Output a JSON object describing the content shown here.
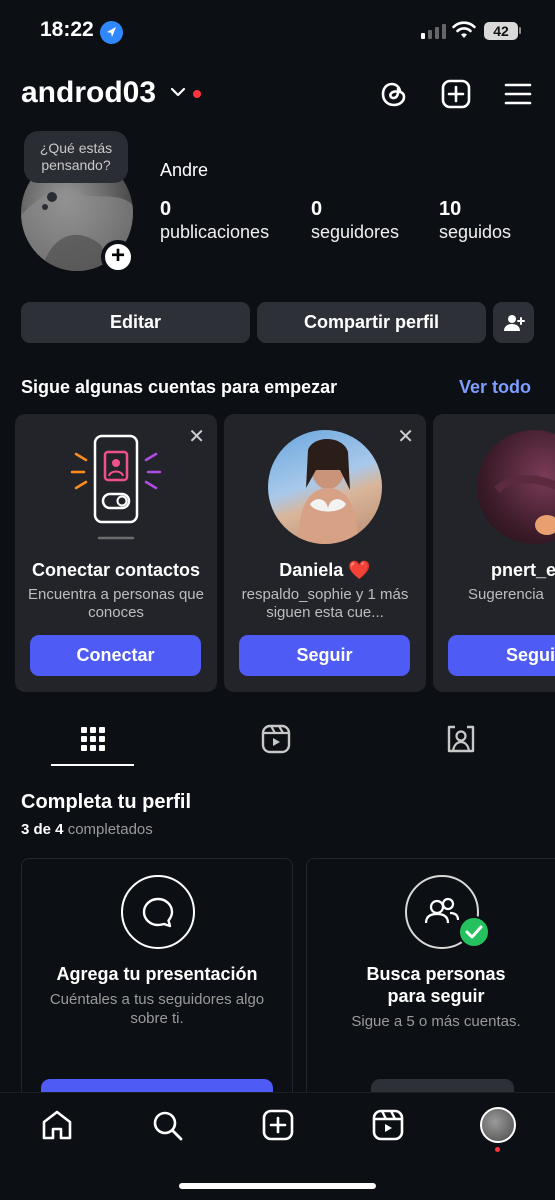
{
  "status": {
    "time": "18:22",
    "battery": "42"
  },
  "header": {
    "username": "androd03"
  },
  "profile": {
    "note": "¿Qué estás pensando?",
    "name": "Andre",
    "stats": [
      {
        "value": "0",
        "label": "publicaciones"
      },
      {
        "value": "0",
        "label": "seguidores"
      },
      {
        "value": "10",
        "label": "seguidos"
      }
    ]
  },
  "actions": {
    "edit": "Editar",
    "share": "Compartir perfil"
  },
  "suggestions": {
    "title": "Sigue algunas cuentas para empezar",
    "see_all": "Ver todo",
    "cards": [
      {
        "title": "Conectar contactos",
        "subtitle": "Encuentra a personas que conoces",
        "button": "Conectar"
      },
      {
        "title": "Daniela ❤️",
        "subtitle": "respaldo_sophie y 1 más siguen esta cue...",
        "button": "Seguir"
      },
      {
        "title": "pnert_e",
        "subtitle": "Sugerencia",
        "button": "Segui"
      }
    ]
  },
  "complete": {
    "title": "Completa tu perfil",
    "progress_bold": "3 de 4",
    "progress_rest": "completados",
    "cards": [
      {
        "title": "Agrega tu presentación",
        "subtitle": "Cuéntales a tus seguidores algo sobre ti."
      },
      {
        "title": "Busca personas para seguir",
        "subtitle": "Sigue a 5 o más cuentas."
      }
    ]
  },
  "colors": {
    "accent": "#4f5bf5",
    "link": "#7d9dff",
    "background": "#0c0f14",
    "notification": "#ff3040",
    "check": "#25c15f"
  }
}
